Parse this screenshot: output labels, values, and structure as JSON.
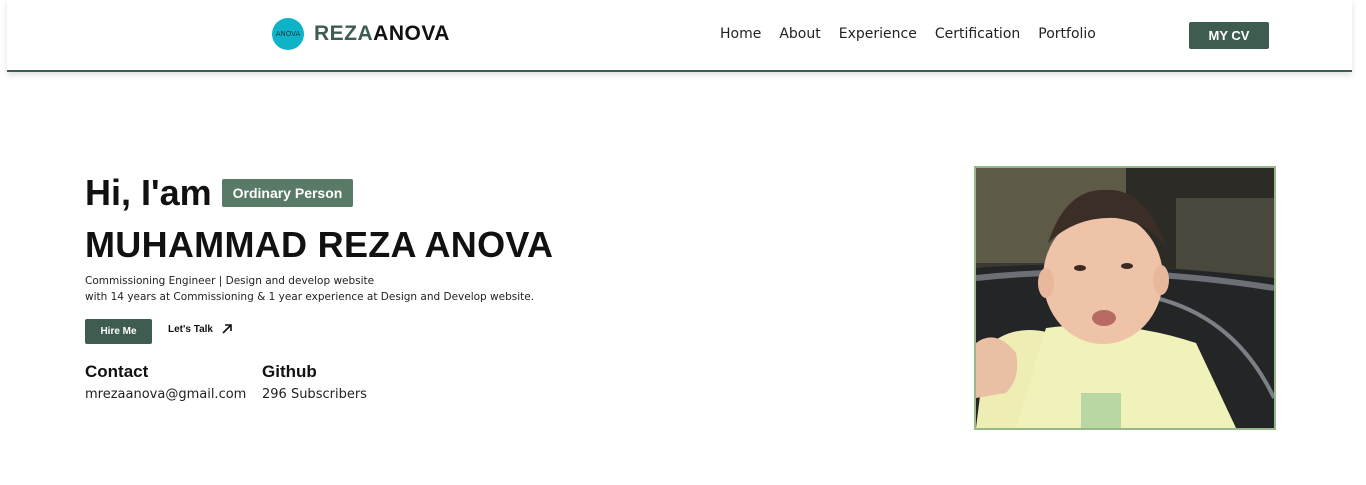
{
  "header": {
    "logo_text": "ANOVA",
    "brand_accent": "REZA",
    "brand_rest": "ANOVA",
    "nav": [
      "Home",
      "About",
      "Experience",
      "Certification",
      "Portfolio"
    ],
    "cv_label": "MY CV"
  },
  "hero": {
    "greeting": "Hi, I'am",
    "badge": "Ordinary Person",
    "name": "MUHAMMAD REZA ANOVA",
    "desc_line1": "Commissioning Engineer | Design and develop website",
    "desc_line2": "with 14 years at Commissioning & 1 year experience at Design and Develop website.",
    "hire_label": "Hire Me",
    "talk_label": "Let's Talk"
  },
  "contact": {
    "title": "Contact",
    "value": "mrezaanova@gmail.com"
  },
  "github": {
    "title": "Github",
    "value": "296 Subscribers"
  },
  "colors": {
    "primary": "#3e5c50",
    "badge": "#587a66",
    "logo": "#0fb3c8",
    "photo_border": "#97b98a"
  }
}
